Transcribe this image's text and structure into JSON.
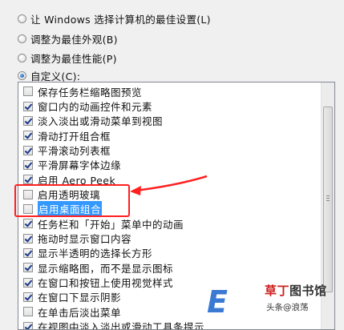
{
  "radios": [
    {
      "label": "让 Windows 选择计算机的最佳设置(L)",
      "checked": false
    },
    {
      "label": "调整为最佳外观(B)",
      "checked": false
    },
    {
      "label": "调整为最佳性能(P)",
      "checked": false
    },
    {
      "label": "自定义(C):",
      "checked": true
    }
  ],
  "items": [
    {
      "label": "保存任务栏缩略图预览",
      "checked": false,
      "selected": false
    },
    {
      "label": "窗口内的动画控件和元素",
      "checked": true,
      "selected": false
    },
    {
      "label": "淡入淡出或滑动菜单到视图",
      "checked": true,
      "selected": false
    },
    {
      "label": "滑动打开组合框",
      "checked": true,
      "selected": false
    },
    {
      "label": "平滑滚动列表框",
      "checked": true,
      "selected": false
    },
    {
      "label": "平滑屏幕字体边缘",
      "checked": true,
      "selected": false
    },
    {
      "label": "启用 Aero Peek",
      "checked": true,
      "selected": false
    },
    {
      "label": "启用透明玻璃",
      "checked": false,
      "selected": false
    },
    {
      "label": "启用桌面组合",
      "checked": false,
      "selected": true
    },
    {
      "label": "任务栏和「开始」菜单中的动画",
      "checked": true,
      "selected": false
    },
    {
      "label": "拖动时显示窗口内容",
      "checked": true,
      "selected": false
    },
    {
      "label": "显示半透明的选择长方形",
      "checked": true,
      "selected": false
    },
    {
      "label": "显示缩略图，而不是显示图标",
      "checked": true,
      "selected": false
    },
    {
      "label": "在窗口和按钮上使用视觉样式",
      "checked": true,
      "selected": false
    },
    {
      "label": "在窗口下显示阴影",
      "checked": true,
      "selected": false
    },
    {
      "label": "在单击后淡出菜单",
      "checked": false,
      "selected": false
    },
    {
      "label": "在视图中淡入淡出或滑动工具条提示",
      "checked": true,
      "selected": false
    }
  ],
  "watermark": {
    "letter": "E",
    "brand_red": "草丁",
    "brand_black": "图书馆",
    "sub": "头条@浪荡"
  },
  "colors": {
    "highlight": "#ff2020",
    "selection": "#3399ff",
    "watermark_blue": "#2a6fd0"
  }
}
